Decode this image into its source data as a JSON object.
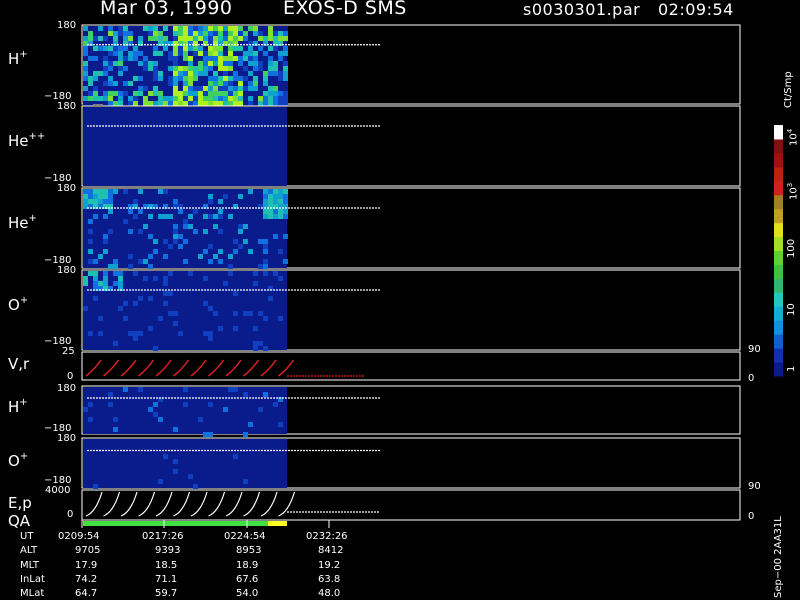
{
  "header": {
    "date": "Mar 03, 1990",
    "instrument": "EXOS-D SMS",
    "file": "s0030301.par",
    "time": "02:09:54"
  },
  "colors": {
    "bg_dark_blue": "#0a1c8c",
    "bg_black": "#000000",
    "trace_red": "#e02020",
    "trace_white": "#ffffff",
    "qa_good": "#40e040",
    "qa_warn": "#ffff20"
  },
  "colorbar": {
    "unit_label": "Ct/Smp",
    "tick_labels": [
      "1",
      "10",
      "100",
      "10",
      "10"
    ],
    "tick_exponents": [
      "",
      "",
      "",
      "3",
      "4"
    ]
  },
  "panels": [
    {
      "id": "h-plus-top",
      "species": "H",
      "charge": "+",
      "top_tick": "180",
      "bottom_tick": "−180"
    },
    {
      "id": "he-plus-plus",
      "species": "He",
      "charge": "++",
      "top_tick": "180",
      "bottom_tick": "−180"
    },
    {
      "id": "he-plus",
      "species": "He",
      "charge": "+",
      "top_tick": "180",
      "bottom_tick": "−180"
    },
    {
      "id": "o-plus-top",
      "species": "O",
      "charge": "+",
      "top_tick": "180",
      "bottom_tick": "−180"
    },
    {
      "id": "vr",
      "species": "V,r",
      "charge": "",
      "top_tick": "25",
      "bottom_tick": "0",
      "right_top": "90",
      "right_bottom": "0"
    },
    {
      "id": "h-plus-bottom",
      "species": "H",
      "charge": "+",
      "top_tick": "180",
      "bottom_tick": "−180"
    },
    {
      "id": "o-plus-bottom",
      "species": "O",
      "charge": "+",
      "top_tick": "180",
      "bottom_tick": "−180"
    },
    {
      "id": "ep-qa",
      "species": "E,p",
      "species2": "QA",
      "charge": "",
      "top_tick": "4000",
      "bottom_tick": "0",
      "right_top": "90",
      "right_bottom": "0"
    }
  ],
  "ephemeris": {
    "labels": [
      "UT",
      "ALT",
      "MLT",
      "InLat",
      "MLat"
    ],
    "columns": [
      [
        "0209:54",
        "9705",
        "17.9",
        "74.2",
        "64.7"
      ],
      [
        "0217:26",
        "9393",
        "18.5",
        "71.1",
        "59.7"
      ],
      [
        "0224:54",
        "8953",
        "18.9",
        "67.6",
        "54.0"
      ],
      [
        "0232:26",
        "8412",
        "19.2",
        "63.8",
        "48.0"
      ]
    ]
  },
  "footer_vertical": "Sep−00  2AA31L",
  "chart_data": {
    "type": "heatmap",
    "title": "Mar 03, 1990   EXOS-D SMS",
    "x_tick_labels": [
      "0209:54",
      "0217:26",
      "0224:54",
      "0232:26"
    ],
    "data_coverage_fraction": 0.49,
    "colorbar_scale": "log",
    "colorbar_range": [
      1,
      10000
    ],
    "panels": [
      {
        "name": "H+",
        "ylim": [
          -180,
          180
        ],
        "level": "high"
      },
      {
        "name": "He++",
        "ylim": [
          -180,
          180
        ],
        "level": "low"
      },
      {
        "name": "He+",
        "ylim": [
          -180,
          180
        ],
        "level": "low-medium"
      },
      {
        "name": "O+",
        "ylim": [
          -180,
          180
        ],
        "level": "low"
      },
      {
        "name": "V,r",
        "ylim": [
          0,
          25
        ],
        "right_axis": [
          0,
          90
        ],
        "sweeps": 12
      },
      {
        "name": "H+",
        "ylim": [
          -180,
          180
        ],
        "level": "sparse"
      },
      {
        "name": "O+",
        "ylim": [
          -180,
          180
        ],
        "level": "sparse"
      },
      {
        "name": "E,p QA",
        "ylim": [
          0,
          4000
        ],
        "right_axis": [
          0,
          90
        ],
        "sweeps": 12
      }
    ]
  }
}
